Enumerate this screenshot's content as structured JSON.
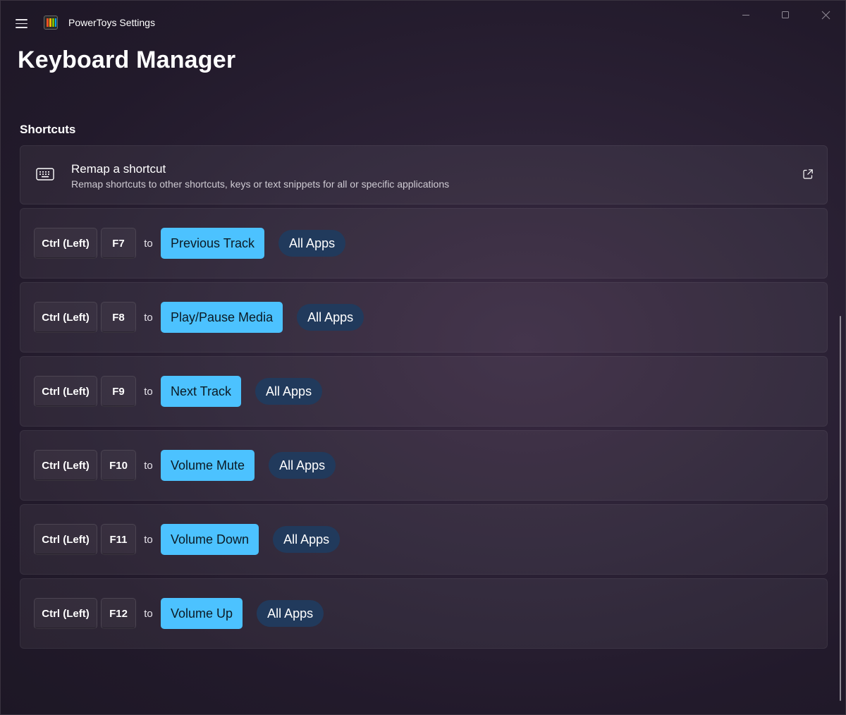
{
  "app": {
    "title": "PowerToys Settings",
    "logo_icon": "powertoys-logo",
    "colors": {
      "accent": "#4cc2ff",
      "pill": "#213a5c",
      "background": "#2a2130"
    }
  },
  "window_controls": {
    "minimize_icon": "minimize-icon",
    "maximize_icon": "maximize-icon",
    "close_icon": "close-icon"
  },
  "page": {
    "title": "Keyboard Manager"
  },
  "shortcuts_section": {
    "title": "Shortcuts",
    "remap_card": {
      "icon": "keyboard-icon",
      "title": "Remap a shortcut",
      "description": "Remap shortcuts to other shortcuts, keys or text snippets for all or specific applications",
      "action_icon": "open-external-icon"
    },
    "mappings": [
      {
        "modifier": "Ctrl (Left)",
        "key": "F7",
        "to": "to",
        "target": "Previous Track",
        "scope": "All Apps"
      },
      {
        "modifier": "Ctrl (Left)",
        "key": "F8",
        "to": "to",
        "target": "Play/Pause Media",
        "scope": "All Apps"
      },
      {
        "modifier": "Ctrl (Left)",
        "key": "F9",
        "to": "to",
        "target": "Next Track",
        "scope": "All Apps"
      },
      {
        "modifier": "Ctrl (Left)",
        "key": "F10",
        "to": "to",
        "target": "Volume Mute",
        "scope": "All Apps"
      },
      {
        "modifier": "Ctrl (Left)",
        "key": "F11",
        "to": "to",
        "target": "Volume Down",
        "scope": "All Apps"
      },
      {
        "modifier": "Ctrl (Left)",
        "key": "F12",
        "to": "to",
        "target": "Volume Up",
        "scope": "All Apps"
      }
    ]
  }
}
